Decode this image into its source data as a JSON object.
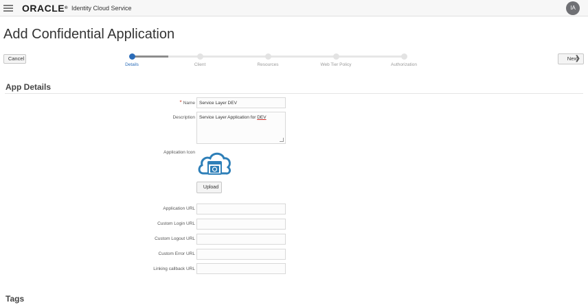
{
  "header": {
    "logo_text": "ORACLE",
    "logo_reg": "®",
    "product_name": "Identity Cloud Service",
    "avatar_initials": "IA",
    "avatar_color": "#6f7074"
  },
  "page": {
    "title": "Add Confidential Application"
  },
  "toolbar": {
    "cancel_label": "Cancel",
    "next_label": "Next",
    "next_icon": "chevron-right-icon"
  },
  "train": {
    "accent_color": "#2b6cb8",
    "steps": [
      {
        "label": "Details",
        "active": true
      },
      {
        "label": "Client",
        "active": false
      },
      {
        "label": "Resources",
        "active": false
      },
      {
        "label": "Web Tier Policy",
        "active": false
      },
      {
        "label": "Authorization",
        "active": false
      }
    ]
  },
  "app_details": {
    "section_title": "App Details",
    "required_marker": "*",
    "name_label": "Name",
    "name_value": "Service Layer DEV",
    "description_label": "Description",
    "description_value_prefix": "Service Layer Application for ",
    "description_value_underlined": "DEV",
    "icon_label": "Application Icon",
    "icon_name": "cloud-application-icon",
    "upload_label": "Upload",
    "application_url_label": "Application URL",
    "application_url_value": "",
    "custom_login_url_label": "Custom Login URL",
    "custom_login_url_value": "",
    "custom_logout_url_label": "Custom Logout URL",
    "custom_logout_url_value": "",
    "custom_error_url_label": "Custom Error URL",
    "custom_error_url_value": "",
    "linking_callback_url_label": "Linking callback URL",
    "linking_callback_url_value": ""
  },
  "tags": {
    "section_title": "Tags"
  }
}
